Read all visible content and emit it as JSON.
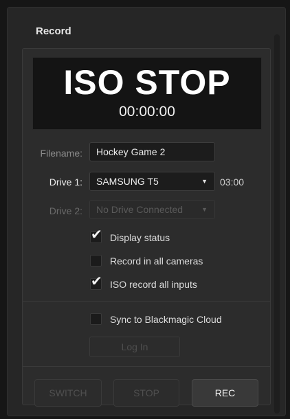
{
  "panel": {
    "title": "Record"
  },
  "display": {
    "status": "ISO STOP",
    "timecode": "00:00:00"
  },
  "filename": {
    "label": "Filename:",
    "value": "Hockey Game 2"
  },
  "drive1": {
    "label": "Drive 1:",
    "value": "SAMSUNG T5",
    "time_remaining": "03:00"
  },
  "drive2": {
    "label": "Drive 2:",
    "value": "No Drive Connected"
  },
  "options": [
    {
      "label": "Display status",
      "checked": true
    },
    {
      "label": "Record in all cameras",
      "checked": false
    },
    {
      "label": "ISO record all inputs",
      "checked": true
    }
  ],
  "cloud": {
    "sync_label": "Sync to Blackmagic Cloud",
    "sync_checked": false,
    "login_label": "Log In"
  },
  "buttons": {
    "switch_label": "SWITCH",
    "stop_label": "STOP",
    "rec_label": "REC"
  },
  "icons": {
    "check": "checkmark-icon",
    "dropdown": "chevron-down-icon"
  }
}
